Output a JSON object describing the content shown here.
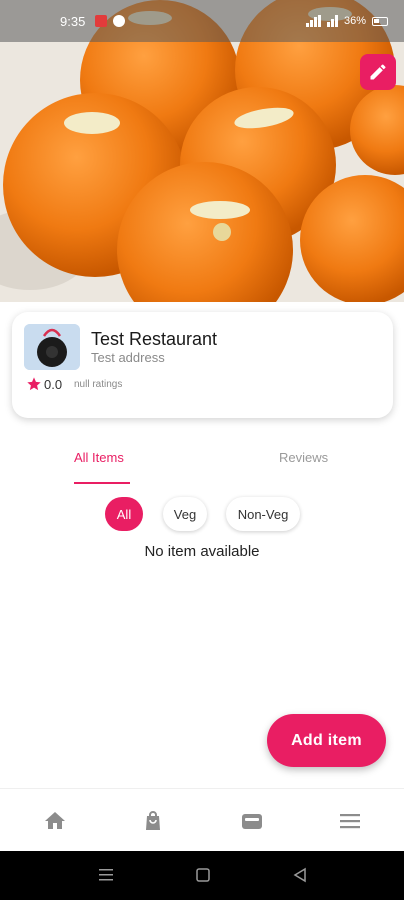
{
  "status_bar": {
    "time": "9:35",
    "battery": "36%"
  },
  "hero": {
    "image": "laddu-sweets-photo",
    "edit_icon": "pencil-icon"
  },
  "restaurant": {
    "name": "Test Restaurant",
    "address": "Test address",
    "logo": "speaker-logo",
    "rating": "0.0",
    "ratings_count": "null ratings"
  },
  "tabs": [
    {
      "label": "All Items",
      "active": true
    },
    {
      "label": "Reviews",
      "active": false
    }
  ],
  "filters": [
    {
      "label": "All",
      "selected": true
    },
    {
      "label": "Veg",
      "selected": false
    },
    {
      "label": "Non-Veg",
      "selected": false
    }
  ],
  "empty_message": "No item available",
  "fab": {
    "label": "Add item"
  },
  "bottom_nav": [
    {
      "icon": "home-icon"
    },
    {
      "icon": "shopping-bag-icon"
    },
    {
      "icon": "wallet-icon"
    },
    {
      "icon": "menu-icon"
    }
  ],
  "colors": {
    "accent": "#e91e63",
    "muted_text": "#8a8a8a",
    "icon_gray": "#8c8c8c"
  }
}
